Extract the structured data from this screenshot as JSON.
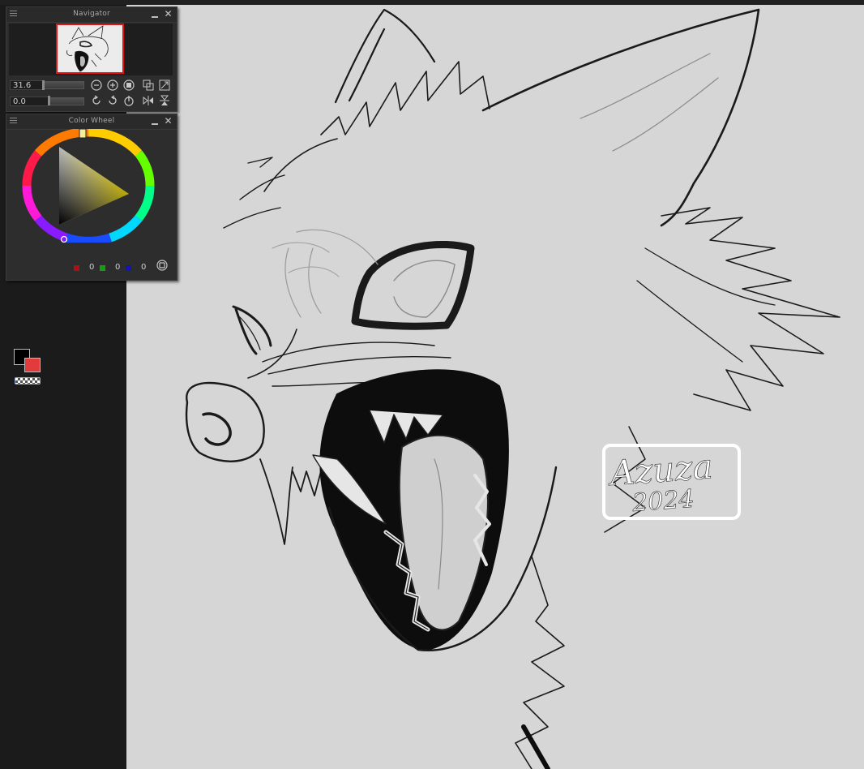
{
  "navigator": {
    "title": "Navigator",
    "zoom_value": "31.6",
    "rotation_value": "0.0",
    "icons": [
      "menu-icon",
      "minimize-icon",
      "close-icon",
      "zoom-out-icon",
      "zoom-in-icon",
      "fit-icon",
      "actual-size-icon",
      "fit-window-icon",
      "rotate-left-icon",
      "rotate-right-icon",
      "reset-rotation-icon",
      "flip-horizontal-icon",
      "flip-vertical-icon"
    ]
  },
  "color_wheel": {
    "title": "Color Wheel",
    "foreground_color": "#000000",
    "background_color": "#e33b3b",
    "red": "0",
    "green": "0",
    "blue": "0",
    "red_swatch": "#b01010",
    "green_swatch": "#10a010",
    "blue_swatch": "#1414b8"
  },
  "canvas": {
    "background": "#d6d6d6",
    "signature_name": "Azuza",
    "signature_year": "2024"
  },
  "colors": {
    "navigator_frame": "#e01515",
    "panel_bg": "#2d2d2d",
    "dock_bg": "#1b1b1b"
  }
}
